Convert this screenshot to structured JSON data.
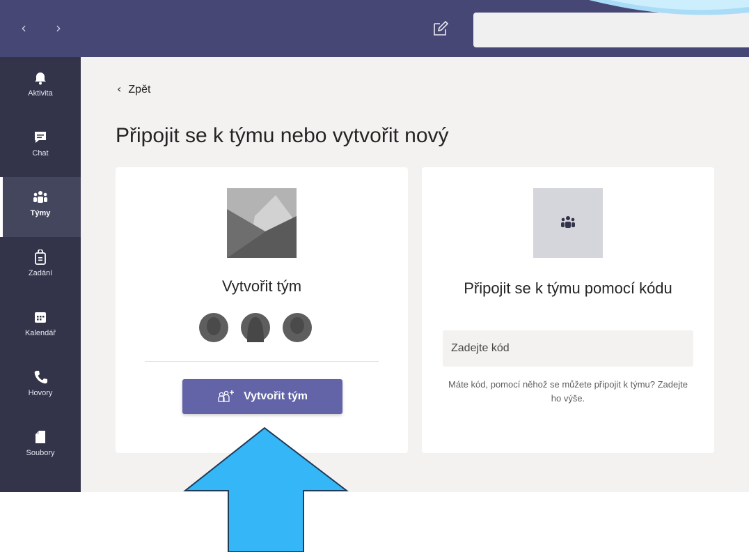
{
  "topbar": {
    "back_icon": "chevron-left",
    "forward_icon": "chevron-right",
    "compose_icon": "compose-icon",
    "search_value": ""
  },
  "rail": {
    "items": [
      {
        "label": "Aktivita",
        "icon": "bell-icon"
      },
      {
        "label": "Chat",
        "icon": "chat-icon"
      },
      {
        "label": "Týmy",
        "icon": "teams-icon",
        "active": true
      },
      {
        "label": "Zadání",
        "icon": "assignments-icon"
      },
      {
        "label": "Kalendář",
        "icon": "calendar-icon"
      },
      {
        "label": "Hovory",
        "icon": "phone-icon"
      },
      {
        "label": "Soubory",
        "icon": "file-icon"
      }
    ]
  },
  "main": {
    "back_label": "Zpět",
    "title": "Připojit se k týmu nebo vytvořit nový",
    "create_card": {
      "heading": "Vytvořit tým",
      "button_label": "Vytvořit tým"
    },
    "join_card": {
      "heading": "Připojit se k týmu pomocí kódu",
      "input_placeholder": "Zadejte kód",
      "hint": "Máte kód, pomocí něhož se můžete připojit k týmu? Zadejte ho výše."
    }
  },
  "colors": {
    "topbar": "#464775",
    "rail": "#33344a",
    "accent": "#6264a7",
    "arrow": "#35b6f7"
  }
}
